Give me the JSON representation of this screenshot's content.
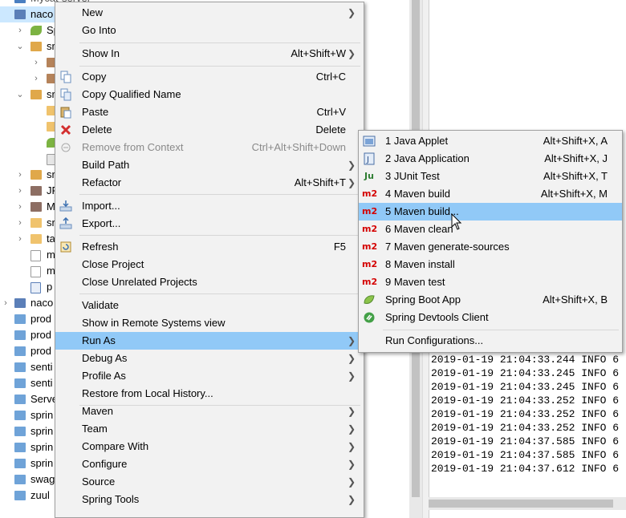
{
  "project_tree": {
    "rows": [
      {
        "label": "Mycat-server"
      },
      {
        "label": "naco"
      },
      {
        "label": "Sp"
      },
      {
        "label": "sr"
      },
      {
        "label": ""
      },
      {
        "label": ""
      },
      {
        "label": "sr"
      },
      {
        "label": ""
      },
      {
        "label": ""
      },
      {
        "label": ""
      },
      {
        "label": ""
      },
      {
        "label": "sr"
      },
      {
        "label": "JF"
      },
      {
        "label": "M"
      },
      {
        "label": "sr"
      },
      {
        "label": "ta"
      },
      {
        "label": "m"
      },
      {
        "label": "m"
      },
      {
        "label": "p"
      },
      {
        "label": "naco"
      },
      {
        "label": "prod"
      },
      {
        "label": "prod"
      },
      {
        "label": "prod"
      },
      {
        "label": "senti"
      },
      {
        "label": "senti"
      },
      {
        "label": "Serve"
      },
      {
        "label": "sprin"
      },
      {
        "label": "sprin"
      },
      {
        "label": "sprin"
      },
      {
        "label": "sprin"
      },
      {
        "label": "swag"
      },
      {
        "label": "zuul"
      }
    ]
  },
  "context_menu": {
    "items": [
      {
        "label": "New",
        "shortcut": "",
        "submenu": true
      },
      {
        "label": "Go Into",
        "shortcut": "",
        "submenu": false
      },
      {
        "label": "Show In",
        "shortcut": "Alt+Shift+W",
        "submenu": true
      },
      {
        "label": "Copy",
        "shortcut": "Ctrl+C",
        "submenu": false,
        "icon": "copy-icon"
      },
      {
        "label": "Copy Qualified Name",
        "shortcut": "",
        "submenu": false,
        "icon": "copy-qualified-icon"
      },
      {
        "label": "Paste",
        "shortcut": "Ctrl+V",
        "submenu": false,
        "icon": "paste-icon"
      },
      {
        "label": "Delete",
        "shortcut": "Delete",
        "submenu": false,
        "icon": "delete-icon"
      },
      {
        "label": "Remove from Context",
        "shortcut": "Ctrl+Alt+Shift+Down",
        "submenu": false,
        "disabled": true,
        "icon": "remove-context-icon"
      },
      {
        "label": "Build Path",
        "shortcut": "",
        "submenu": true
      },
      {
        "label": "Refactor",
        "shortcut": "Alt+Shift+T",
        "submenu": true
      },
      {
        "label": "Import...",
        "shortcut": "",
        "submenu": false,
        "icon": "import-icon"
      },
      {
        "label": "Export...",
        "shortcut": "",
        "submenu": false,
        "icon": "export-icon"
      },
      {
        "label": "Refresh",
        "shortcut": "F5",
        "submenu": false,
        "icon": "refresh-icon"
      },
      {
        "label": "Close Project",
        "shortcut": "",
        "submenu": false
      },
      {
        "label": "Close Unrelated Projects",
        "shortcut": "",
        "submenu": false
      },
      {
        "label": "Validate",
        "shortcut": "",
        "submenu": false
      },
      {
        "label": "Show in Remote Systems view",
        "shortcut": "",
        "submenu": false
      },
      {
        "label": "Run As",
        "shortcut": "",
        "submenu": true,
        "highlighted": true
      },
      {
        "label": "Debug As",
        "shortcut": "",
        "submenu": true
      },
      {
        "label": "Profile As",
        "shortcut": "",
        "submenu": true
      },
      {
        "label": "Restore from Local History...",
        "shortcut": "",
        "submenu": false
      },
      {
        "label": "Maven",
        "shortcut": "",
        "submenu": true
      },
      {
        "label": "Team",
        "shortcut": "",
        "submenu": true
      },
      {
        "label": "Compare With",
        "shortcut": "",
        "submenu": true
      },
      {
        "label": "Configure",
        "shortcut": "",
        "submenu": true
      },
      {
        "label": "Source",
        "shortcut": "",
        "submenu": true
      },
      {
        "label": "Spring Tools",
        "shortcut": "",
        "submenu": true
      }
    ]
  },
  "run_as_submenu": {
    "items": [
      {
        "label": "1 Java Applet",
        "shortcut": "Alt+Shift+X, A",
        "icon": "java-applet-icon"
      },
      {
        "label": "2 Java Application",
        "shortcut": "Alt+Shift+X, J",
        "icon": "java-application-icon"
      },
      {
        "label": "3 JUnit Test",
        "shortcut": "Alt+Shift+X, T",
        "icon": "junit-icon",
        "icon_text": "Ju"
      },
      {
        "label": "4 Maven build",
        "shortcut": "Alt+Shift+X, M",
        "icon": "maven-icon",
        "icon_text": "m2"
      },
      {
        "label": "5 Maven build...",
        "shortcut": "",
        "icon": "maven-icon",
        "icon_text": "m2",
        "highlighted": true
      },
      {
        "label": "6 Maven clean",
        "shortcut": "",
        "icon": "maven-icon",
        "icon_text": "m2"
      },
      {
        "label": "7 Maven generate-sources",
        "shortcut": "",
        "icon": "maven-icon",
        "icon_text": "m2"
      },
      {
        "label": "8 Maven install",
        "shortcut": "",
        "icon": "maven-icon",
        "icon_text": "m2"
      },
      {
        "label": "9 Maven test",
        "shortcut": "",
        "icon": "maven-icon",
        "icon_text": "m2"
      },
      {
        "label": "Spring Boot App",
        "shortcut": "Alt+Shift+X, B",
        "icon": "spring-boot-icon"
      },
      {
        "label": "Spring Devtools Client",
        "shortcut": "",
        "icon": "devtools-icon"
      },
      {
        "label": "Run Configurations...",
        "shortcut": ""
      }
    ]
  },
  "console": {
    "lines": [
      "2019-01-19 21:04:33.244  INFO 6",
      "2019-01-19 21:04:33.245  INFO 6",
      "2019-01-19 21:04:33.245  INFO 6",
      "2019-01-19 21:04:33.252  INFO 6",
      "2019-01-19 21:04:33.252  INFO 6",
      "2019-01-19 21:04:33.252  INFO 6",
      "2019-01-19 21:04:37.585  INFO 6",
      "2019-01-19 21:04:37.585  INFO 6",
      "2019-01-19 21:04:37.612  INFO 6"
    ]
  },
  "colors": {
    "highlight": "#91c9f7",
    "menu_bg": "#f2f2f2",
    "maven_red": "#d40000"
  }
}
